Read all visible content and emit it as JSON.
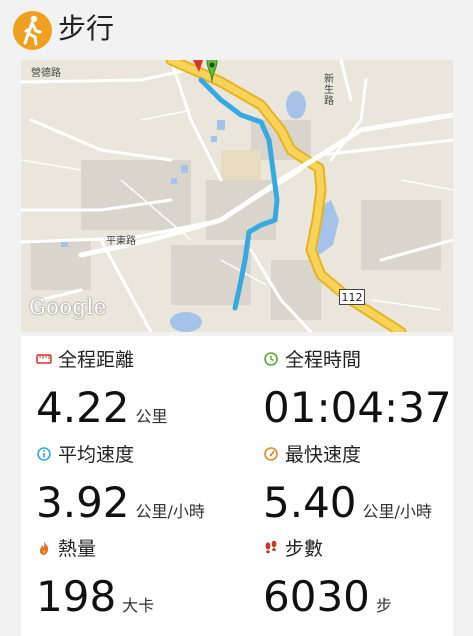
{
  "app": {
    "title": "步行",
    "icon": "walking-person-icon",
    "accent": "#f0a020"
  },
  "map": {
    "road_labels": [
      "營德路",
      "平東路",
      "新生路"
    ],
    "route_shield": "112",
    "attribution": "Google",
    "route_color": "#36a9e1",
    "highway_color": "#f5c842"
  },
  "stats": {
    "distance": {
      "label": "全程距離",
      "value": "4.22",
      "unit": "公里",
      "icon": "ruler-icon"
    },
    "duration": {
      "label": "全程時間",
      "value": "01:04:37",
      "unit": "",
      "icon": "clock-icon"
    },
    "avg_speed": {
      "label": "平均速度",
      "value": "3.92",
      "unit": "公里/小時",
      "icon": "info-icon"
    },
    "max_speed": {
      "label": "最快速度",
      "value": "5.40",
      "unit": "公里/小時",
      "icon": "speedometer-icon"
    },
    "calories": {
      "label": "熱量",
      "value": "198",
      "unit": "大卡",
      "icon": "flame-icon"
    },
    "steps": {
      "label": "步數",
      "value": "6030",
      "unit": "步",
      "icon": "footprints-icon"
    }
  }
}
